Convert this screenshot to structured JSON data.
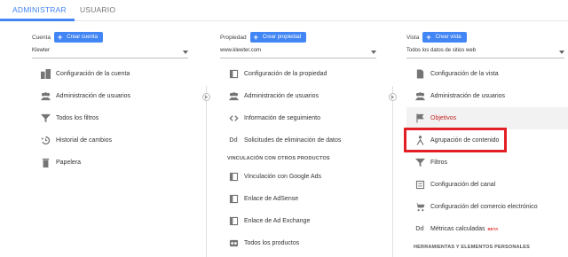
{
  "tabs": [
    {
      "label": "ADMINISTRAR",
      "active": true
    },
    {
      "label": "USUARIO",
      "active": false
    }
  ],
  "account": {
    "label": "Cuenta",
    "create_label": "Crear cuenta",
    "selected": "Klewter",
    "items": [
      {
        "label": "Configuración de la cuenta",
        "icon": "building-icon"
      },
      {
        "label": "Administración de usuarios",
        "icon": "users-icon"
      },
      {
        "label": "Todos los filtros",
        "icon": "filter-icon"
      },
      {
        "label": "Historial de cambios",
        "icon": "history-icon"
      },
      {
        "label": "Papelera",
        "icon": "trash-icon"
      }
    ]
  },
  "property": {
    "label": "Propiedad",
    "create_label": "Crear propiedad",
    "selected": "www.klewter.com",
    "items": [
      {
        "label": "Configuración de la propiedad",
        "icon": "page-icon"
      },
      {
        "label": "Administración de usuarios",
        "icon": "users-icon"
      },
      {
        "label": "Información de seguimiento",
        "icon": "code-icon"
      },
      {
        "label": "Solicitudes de eliminación de datos",
        "icon": "dd-icon"
      }
    ],
    "section_title": "VINCULACIÓN CON OTROS PRODUCTOS",
    "link_items": [
      {
        "label": "Vinculación con Google Ads",
        "icon": "ads-icon"
      },
      {
        "label": "Enlace de AdSense",
        "icon": "page-icon"
      },
      {
        "label": "Enlace de Ad Exchange",
        "icon": "page-icon"
      },
      {
        "label": "Todos los productos",
        "icon": "products-icon"
      }
    ]
  },
  "view": {
    "label": "Vista",
    "create_label": "Crear vista",
    "selected": "Todos los datos de sitios web",
    "items": [
      {
        "label": "Configuración de la vista",
        "icon": "doc-icon"
      },
      {
        "label": "Administración de usuarios",
        "icon": "users-icon"
      },
      {
        "label": "Objetivos",
        "icon": "flag-icon",
        "selected": true
      },
      {
        "label": "Agrupación de contenido",
        "icon": "grouping-icon"
      },
      {
        "label": "Filtros",
        "icon": "filter-icon"
      },
      {
        "label": "Configuración del canal",
        "icon": "channel-icon"
      },
      {
        "label": "Configuración del comercio electrónico",
        "icon": "cart-icon"
      },
      {
        "label": "Métricas calculadas",
        "icon": "dd-icon",
        "badge": "BETA"
      }
    ],
    "section_title": "HERRAMIENTAS Y ELEMENTOS PERSONALES"
  },
  "colors": {
    "accent": "#4285f4",
    "highlight": "#e31e24",
    "selected_text": "#c62828"
  }
}
